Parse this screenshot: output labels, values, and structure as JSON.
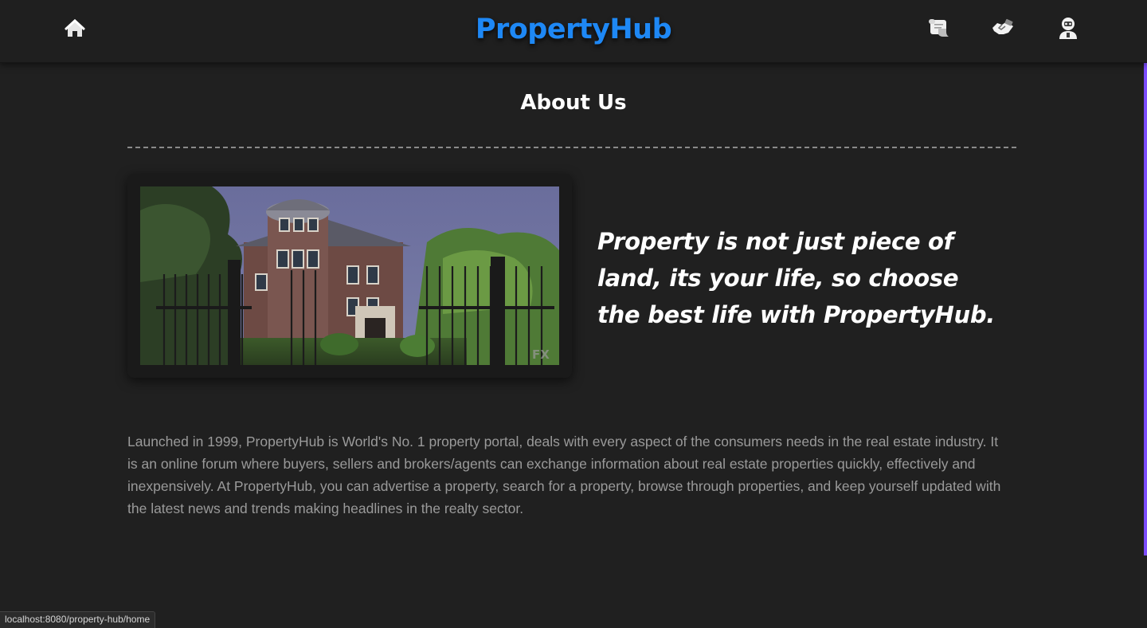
{
  "header": {
    "brand": "PropertyHub",
    "icons": {
      "home": "home-icon",
      "listings": "scroll-icon",
      "deals": "handshake-icon",
      "account": "user-icon"
    }
  },
  "about": {
    "title": "About Us",
    "image_alt": "mansion-photo",
    "image_watermark": "FX",
    "tagline": "Property is not just piece of land, its your life, so choose the best life with PropertyHub.",
    "description": "Launched in 1999, PropertyHub is World's No. 1 property portal, deals with every aspect of the consumers needs in the real estate industry. It is an online forum where buyers, sellers and brokers/agents can exchange information about real estate properties quickly, effectively and inexpensively. At PropertyHub, you can advertise a property, search for a property, browse through properties, and keep yourself updated with the latest news and trends making headlines in the realty sector."
  },
  "status_bar": {
    "url": "localhost:8080/property-hub/home"
  },
  "colors": {
    "background": "#202020",
    "brand": "#1e88f5",
    "accent_strip": "#7c4dff",
    "body_text": "#9a9a9a"
  }
}
